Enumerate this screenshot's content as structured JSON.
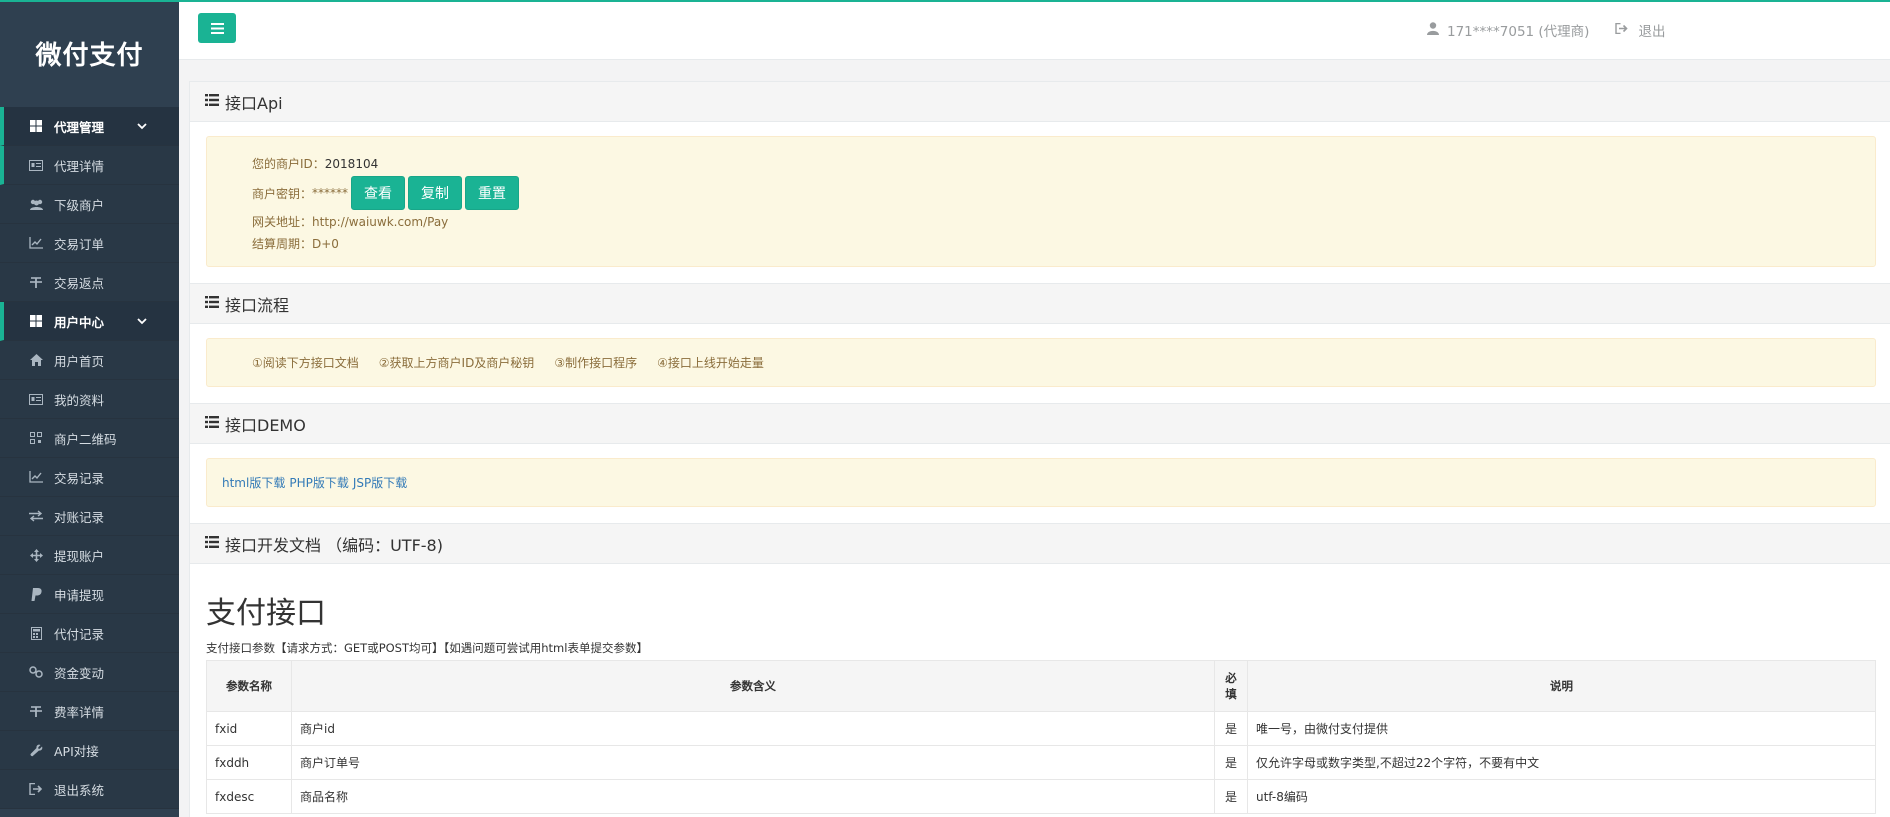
{
  "brand": "微付支付",
  "sidebar": {
    "groups": [
      {
        "label": "代理管理",
        "items": [
          "代理详情",
          "下级商户",
          "交易订单",
          "交易返点"
        ]
      },
      {
        "label": "用户中心",
        "items": [
          "用户首页",
          "我的资料",
          "商户二维码",
          "交易记录",
          "对账记录",
          "提现账户",
          "申请提现",
          "代付记录",
          "资金变动",
          "费率详情",
          "API对接",
          "退出系统"
        ]
      }
    ]
  },
  "topbar": {
    "user": "171****7051 (代理商)",
    "logout": "退出"
  },
  "api": {
    "title": "接口Api",
    "merchant_id_label": "您的商户ID：",
    "merchant_id": "2018104",
    "secret_label": "商户密钥：",
    "secret_mask": "******",
    "btn_view": "查看",
    "btn_copy": "复制",
    "btn_reset": "重置",
    "gateway_label": "网关地址：",
    "gateway": "http://waiuwk.com/Pay",
    "cycle_label": "结算周期：",
    "cycle": "D+0"
  },
  "flow": {
    "title": "接口流程",
    "steps": [
      "①阅读下方接口文档",
      "②获取上方商户ID及商户秘钥",
      "③制作接口程序",
      "④接口上线开始走量"
    ]
  },
  "demo": {
    "title": "接口DEMO",
    "links": [
      "html版下载",
      "PHP版下载",
      "JSP版下载"
    ]
  },
  "doc": {
    "title": "接口开发文档 （编码：UTF-8)",
    "heading": "支付接口",
    "note": "支付接口参数【请求方式：GET或POST均可】【如遇问题可尝试用html表单提交参数】",
    "columns": [
      "参数名称",
      "参数含义",
      "必填",
      "说明"
    ],
    "rows": [
      [
        "fxid",
        "商户id",
        "是",
        "唯一号，由微付支付提供"
      ],
      [
        "fxddh",
        "商户订单号",
        "是",
        "仅允许字母或数字类型,不超过22个字符，不要有中文"
      ],
      [
        "fxdesc",
        "商品名称",
        "是",
        "utf-8编码"
      ]
    ]
  }
}
